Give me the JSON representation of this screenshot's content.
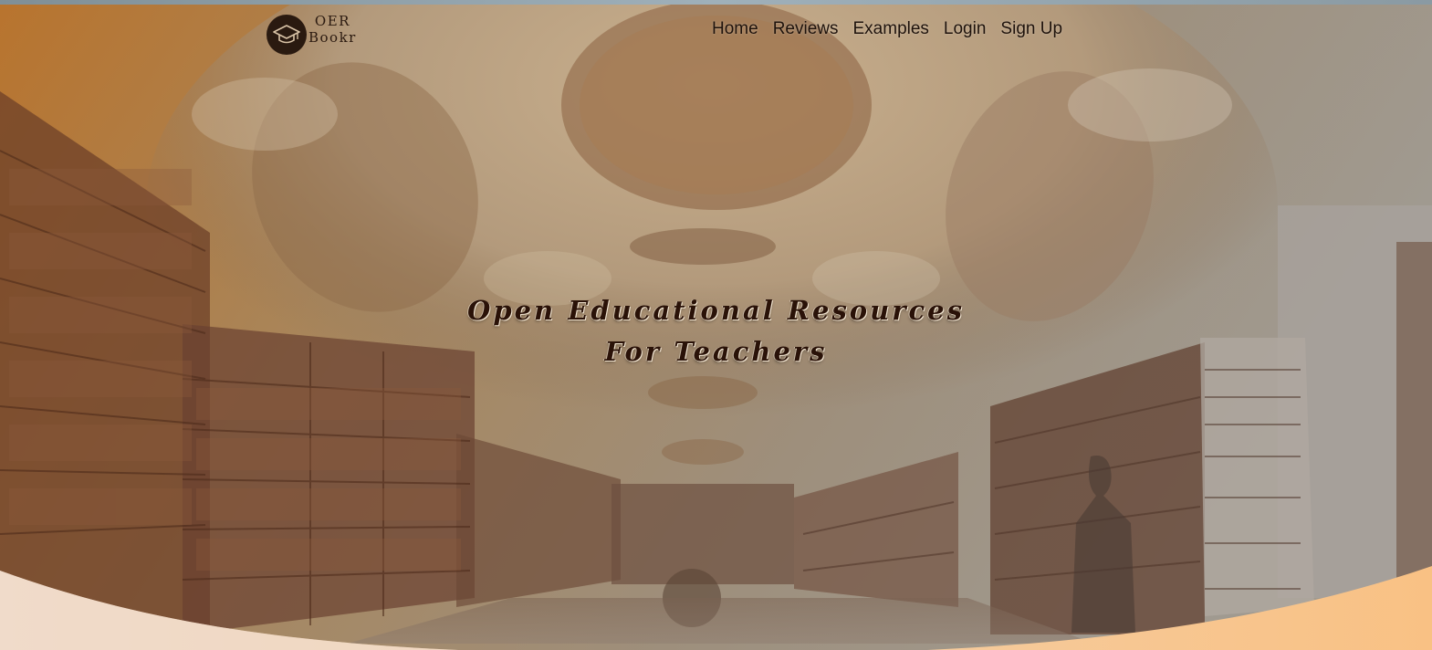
{
  "brand": {
    "line1": "OER",
    "line2": "Bookr",
    "logo_icon": "graduation-cap-icon"
  },
  "nav": {
    "items": [
      {
        "label": "Home"
      },
      {
        "label": "Reviews"
      },
      {
        "label": "Examples"
      },
      {
        "label": "Login"
      },
      {
        "label": "Sign Up"
      }
    ]
  },
  "hero": {
    "headline_line1": "Open Educational Resources",
    "headline_line2": "For Teachers",
    "background": "library-hall-image"
  },
  "colors": {
    "overlay_warm": "#c98a3e",
    "text_dark": "#2a1208",
    "wave_peach": "#f7c890",
    "wave_light": "#ecd6c4"
  }
}
